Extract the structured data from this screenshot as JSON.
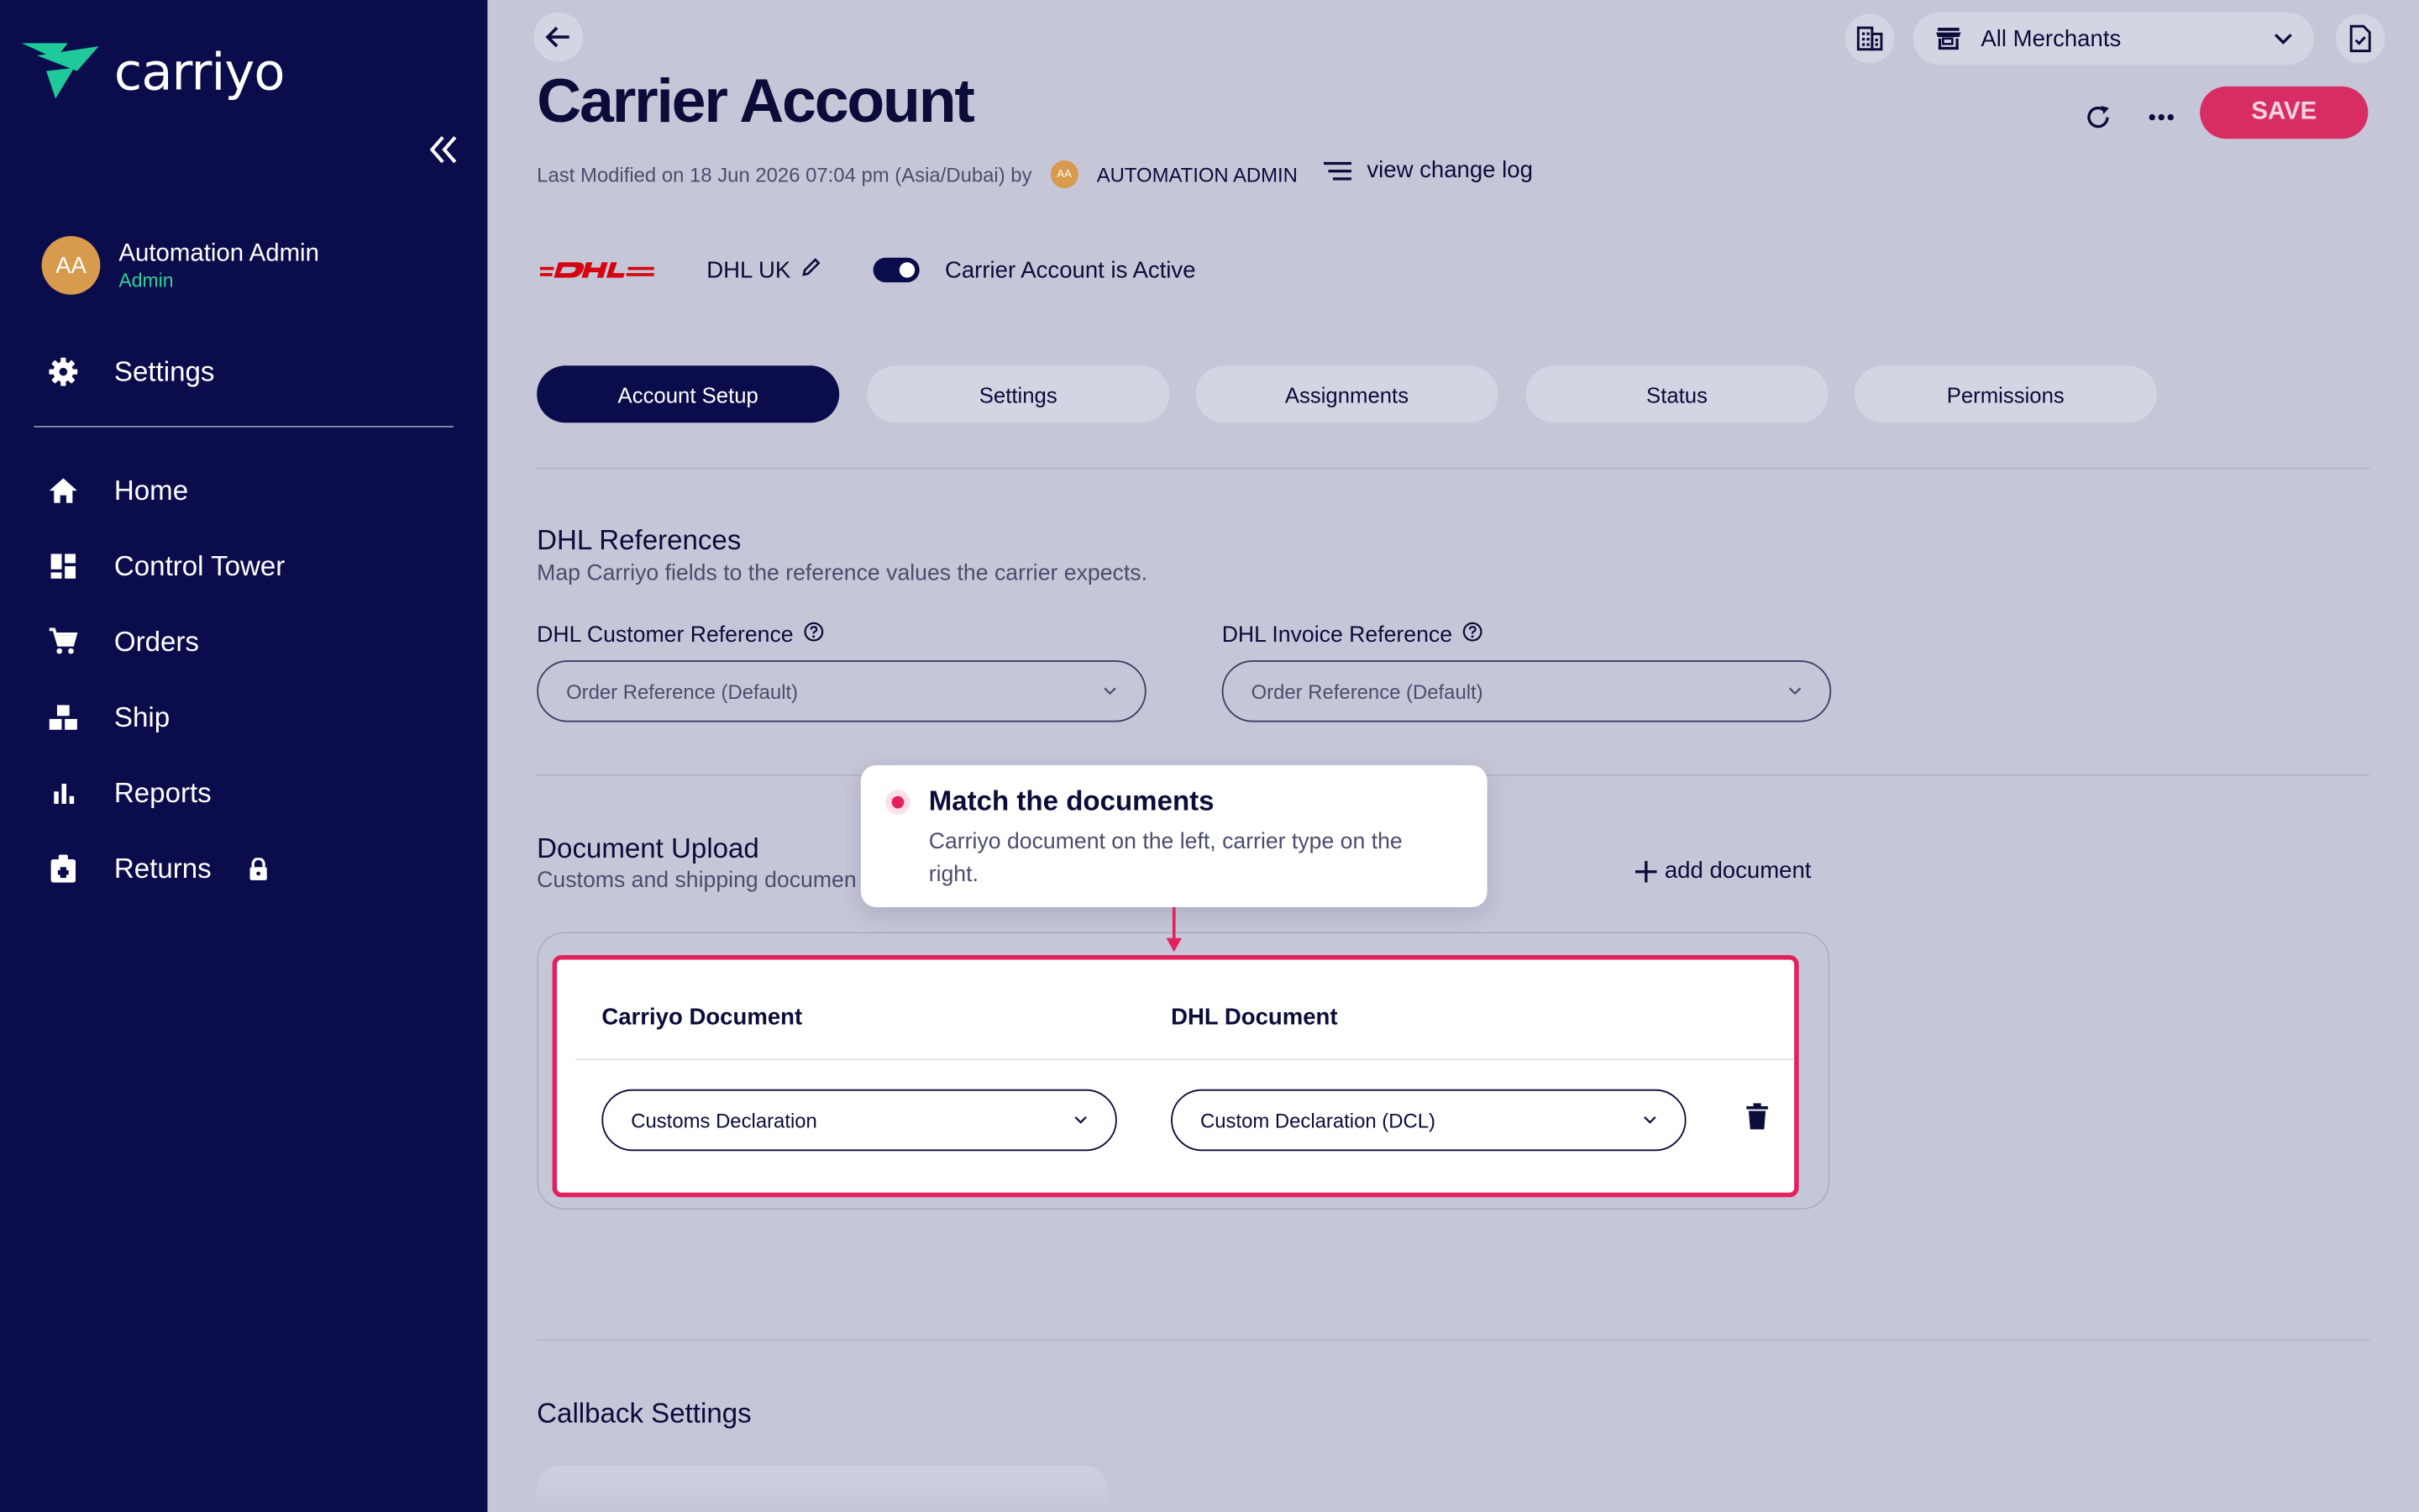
{
  "brand": {
    "name": "carriyo",
    "accent": "#1fc99a",
    "sidebar_bg": "#0b0c4b",
    "primary": "#d82d62"
  },
  "user": {
    "initials": "AA",
    "name": "Automation Admin",
    "role": "Admin"
  },
  "sidebar": {
    "settings": "Settings",
    "items": [
      {
        "label": "Home",
        "icon": "home-icon"
      },
      {
        "label": "Control Tower",
        "icon": "dashboard-icon"
      },
      {
        "label": "Orders",
        "icon": "cart-icon"
      },
      {
        "label": "Ship",
        "icon": "boxes-icon"
      },
      {
        "label": "Reports",
        "icon": "bar-chart-icon"
      },
      {
        "label": "Returns",
        "icon": "return-box-icon"
      }
    ]
  },
  "header": {
    "merchant_select": "All Merchants",
    "title": "Carrier Account",
    "save_label": "SAVE",
    "meta_prefix": "Last Modified on 18 Jun 2026 07:04 pm (Asia/Dubai) by",
    "meta_initials": "AA",
    "meta_user": "AUTOMATION ADMIN",
    "changelog_label": "view change log"
  },
  "carrier": {
    "name": "DHL UK",
    "active_label": "Carrier Account is Active",
    "active": true
  },
  "tabs": [
    {
      "label": "Account Setup",
      "active": true
    },
    {
      "label": "Settings",
      "active": false
    },
    {
      "label": "Assignments",
      "active": false
    },
    {
      "label": "Status",
      "active": false
    },
    {
      "label": "Permissions",
      "active": false
    }
  ],
  "references": {
    "title": "DHL References",
    "subtitle": "Map Carriyo fields to the reference values the carrier expects.",
    "customer_label": "DHL Customer Reference",
    "customer_value": "Order Reference (Default)",
    "invoice_label": "DHL Invoice Reference",
    "invoice_value": "Order Reference (Default)"
  },
  "documents": {
    "title": "Document Upload",
    "subtitle": "Customs and shipping documen",
    "add_label": "add document",
    "col_carriyo": "Carriyo Document",
    "col_carrier": "DHL Document",
    "rows": [
      {
        "carriyo": "Customs Declaration",
        "carrier": "Custom Declaration (DCL)"
      }
    ]
  },
  "tooltip": {
    "title": "Match the documents",
    "body": "Carriyo document on the left, carrier type on the right."
  },
  "callback": {
    "title": "Callback Settings"
  }
}
